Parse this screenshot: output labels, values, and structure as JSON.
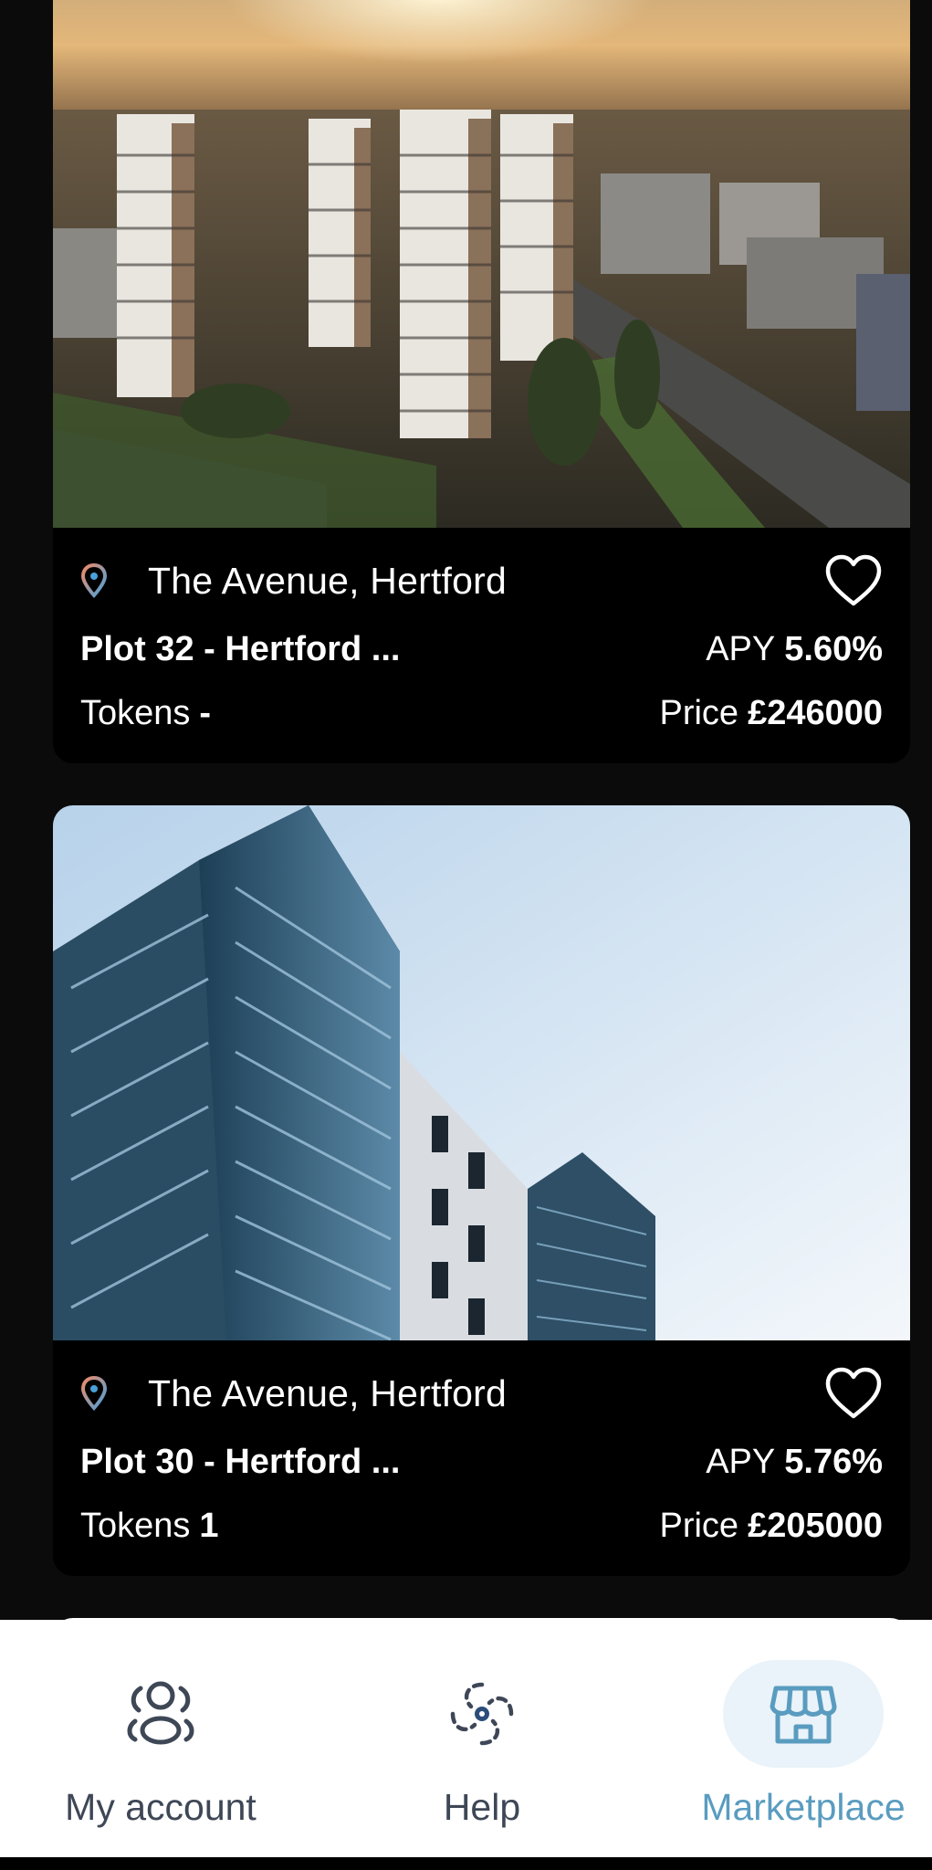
{
  "listings": [
    {
      "location": "The Avenue, Hertford",
      "title": "Plot 32 - Hertford ...",
      "apy_label": "APY",
      "apy_value": "5.60%",
      "tokens_label": "Tokens",
      "tokens_value": "-",
      "price_label": "Price",
      "price_value": "£246000",
      "favorite_icon": "heart-outline-icon",
      "location_icon": "map-pin-icon"
    },
    {
      "location": "The Avenue, Hertford",
      "title": "Plot 30 - Hertford ...",
      "apy_label": "APY",
      "apy_value": "5.76%",
      "tokens_label": "Tokens",
      "tokens_value": "1",
      "price_label": "Price",
      "price_value": "£205000",
      "favorite_icon": "heart-outline-icon",
      "location_icon": "map-pin-icon"
    }
  ],
  "nav": {
    "items": [
      {
        "label": "My account",
        "icon": "account-icon",
        "active": false
      },
      {
        "label": "Help",
        "icon": "help-icon",
        "active": false
      },
      {
        "label": "Marketplace",
        "icon": "storefront-icon",
        "active": true
      }
    ],
    "active_color": "#5a9cc0",
    "inactive_color": "#3e4756"
  }
}
